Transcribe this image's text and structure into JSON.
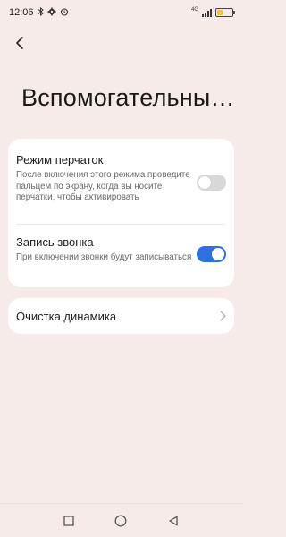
{
  "status_bar": {
    "time": "12:06",
    "network": "4G"
  },
  "header": {
    "title": "Вспомогательны…"
  },
  "settings": {
    "glove_mode": {
      "title": "Режим перчаток",
      "description": "После включения этого режима проведите пальцем по экрану, когда вы носите перчатки, чтобы активировать",
      "enabled": false
    },
    "call_recording": {
      "title": "Запись звонка",
      "description": "При включении звонки будут записываться",
      "enabled": true
    },
    "speaker_cleaning": {
      "title": "Очистка динамика"
    }
  },
  "colors": {
    "background": "#f6ebe8",
    "accent": "#2f6fe0",
    "battery": "#f4c51a"
  },
  "icons": {
    "status": [
      "bluetooth-icon",
      "settings-icon",
      "alarm-icon"
    ],
    "nav": [
      "recent-apps-icon",
      "home-icon",
      "back-nav-icon"
    ]
  }
}
